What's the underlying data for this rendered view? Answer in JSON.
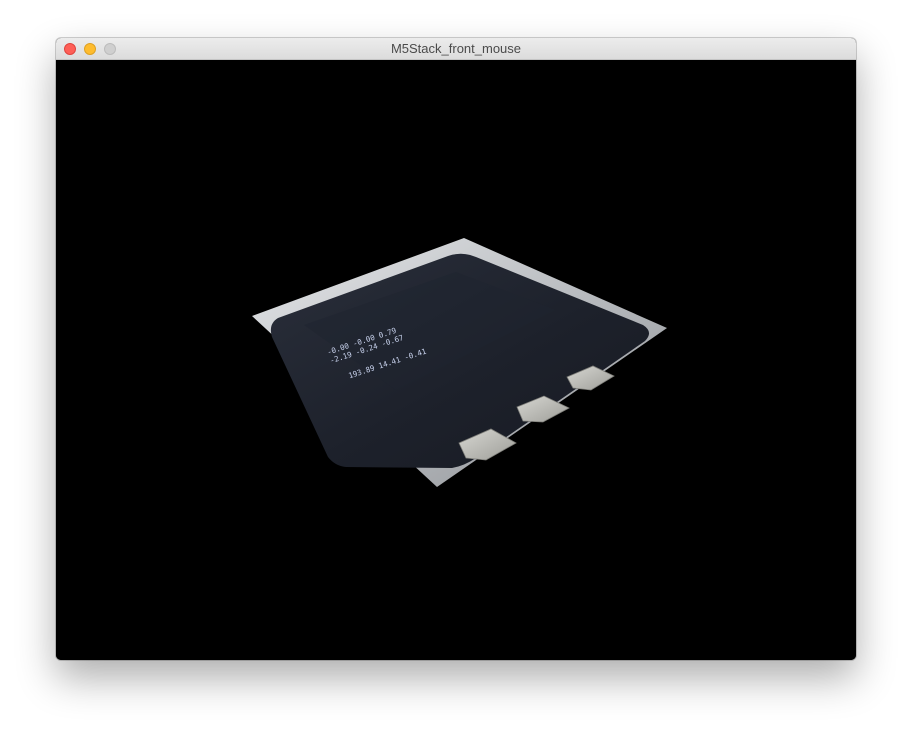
{
  "window": {
    "title": "M5Stack_front_mouse"
  },
  "device": {
    "screen_lines": [
      "-0.00  -0.00  0.79",
      "-2.19  -0.24  -0.67",
      "193.89   14.41   -0.41"
    ],
    "button_count": 3
  },
  "colors": {
    "canvas_background": "#000000",
    "device_body": "#1d212b",
    "device_bezel": "#c9cccf",
    "buttons": "#b8b8b3",
    "screen_text": "#c9d3ee",
    "close": "#fe5f57",
    "minimize": "#febc2e",
    "zoom": "#cfcfcf"
  }
}
